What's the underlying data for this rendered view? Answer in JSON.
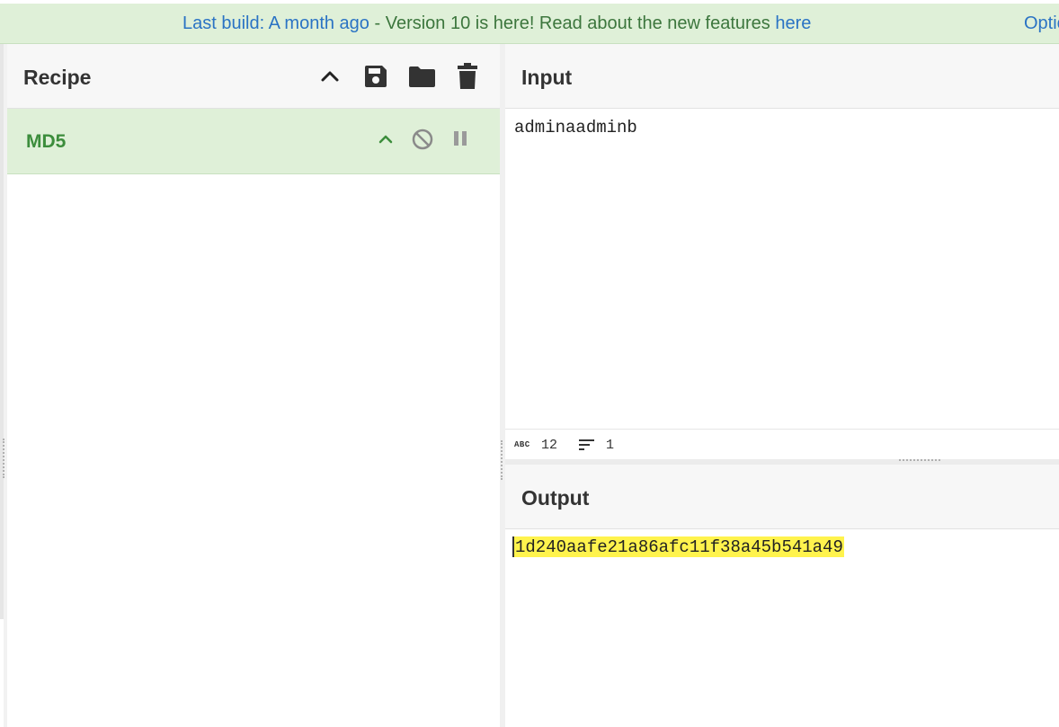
{
  "banner": {
    "prefix": "Last build: A month ago",
    "separator": " - ",
    "message": "Version 10 is here! Read about the new features ",
    "link": "here",
    "options_label": "Options"
  },
  "recipe": {
    "title": "Recipe",
    "actions": [
      "chevron-up-icon",
      "save-icon",
      "folder-icon",
      "trash-icon"
    ],
    "operations": [
      {
        "name": "MD5",
        "controls": [
          "chevron-up-icon",
          "disable-icon",
          "pause-icon"
        ]
      }
    ]
  },
  "input": {
    "title": "Input",
    "value": "adminaadminb",
    "status": {
      "length_label": "ABC",
      "length": "12",
      "lines": "1"
    }
  },
  "output": {
    "title": "Output",
    "value": "1d240aafe21a86afc11f38a45b541a49"
  },
  "colors": {
    "banner_bg": "#dff0d8",
    "op_bg": "#dff0d8",
    "op_text": "#3c8d3c",
    "link": "#2a73c4",
    "highlight": "#fff34d"
  }
}
